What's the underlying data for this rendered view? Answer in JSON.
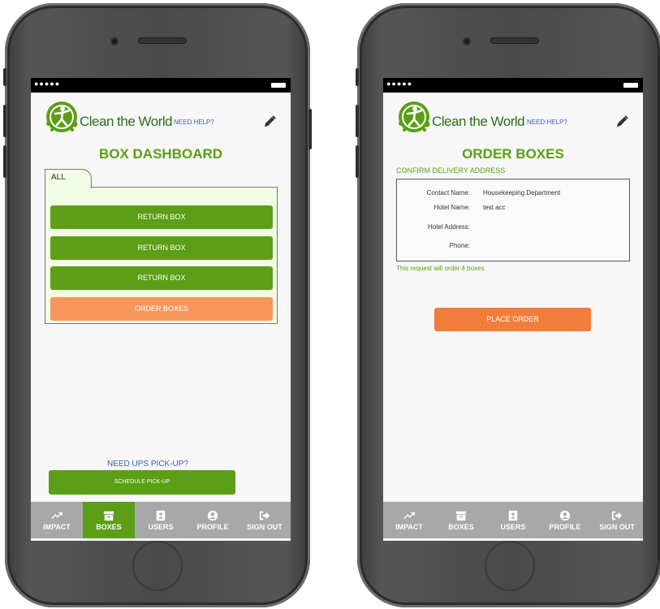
{
  "brand": {
    "name": "Clean the World",
    "need_help": "NEED HELP?"
  },
  "status": {
    "signal": "●●●●●"
  },
  "box_dashboard": {
    "title": "BOX DASHBOARD",
    "tab_label": "ALL",
    "boxes": [
      {
        "label": "RETURN BOX"
      },
      {
        "label": "RETURN BOX"
      },
      {
        "label": "RETURN BOX"
      }
    ],
    "order_boxes_label": "ORDER BOXES",
    "ups_prompt": "NEED UPS PICK-UP?",
    "schedule_pickup_label": "SCHEDULE PICK-UP"
  },
  "order_boxes": {
    "title": "ORDER BOXES",
    "subtitle": "CONFIRM DELIVERY ADDRESS",
    "address": {
      "contact_label": "Contact Name:",
      "contact_value": "Housekeeping Department",
      "hotel_label": "Hotel Name:",
      "hotel_value": "test acc",
      "address_label": "Hotel Address:",
      "address_value": "",
      "phone_label": "Phone:",
      "phone_value": ""
    },
    "order_note": "This request will order 4 boxes",
    "place_order_label": "PLACE ORDER"
  },
  "nav": {
    "items": [
      {
        "label": "IMPACT",
        "icon": "trending-up-icon"
      },
      {
        "label": "BOXES",
        "icon": "archive-box-icon"
      },
      {
        "label": "USERS",
        "icon": "contacts-book-icon"
      },
      {
        "label": "PROFILE",
        "icon": "user-circle-icon"
      },
      {
        "label": "SIGN OUT",
        "icon": "sign-out-icon"
      }
    ],
    "active_left": "BOXES"
  },
  "colors": {
    "brand_green": "#5c9e16",
    "accent_orange": "#f07d3a",
    "light_orange": "#f9955a",
    "link_blue": "#3a5cb8",
    "nav_gray": "#a8a8a8"
  }
}
